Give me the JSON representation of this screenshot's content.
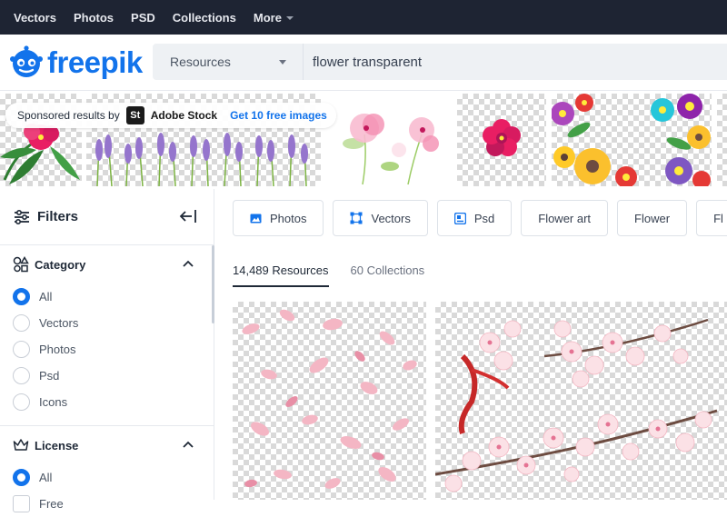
{
  "topnav": {
    "items": [
      "Vectors",
      "Photos",
      "PSD",
      "Collections"
    ],
    "more_label": "More"
  },
  "header": {
    "logo_text": "freepik",
    "resource_select": "Resources",
    "search_value": "flower transparent"
  },
  "sponsored": {
    "by_label": "Sponsored results by",
    "brand_mark": "St",
    "brand_name": "Adobe Stock",
    "free_link": "Get 10 free images"
  },
  "sidebar": {
    "title": "Filters",
    "category": {
      "title": "Category",
      "options": [
        "All",
        "Vectors",
        "Photos",
        "Psd",
        "Icons"
      ],
      "selected": "All"
    },
    "license": {
      "title": "License",
      "options": [
        "All",
        "Free"
      ],
      "selected": "All"
    }
  },
  "main": {
    "chips": [
      "Photos",
      "Vectors",
      "Psd",
      "Flower art",
      "Flower",
      "Fl"
    ],
    "tabs": [
      {
        "label": "14,489 Resources",
        "active": true
      },
      {
        "label": "60 Collections",
        "active": false
      }
    ]
  },
  "colors": {
    "brand": "#1273eb",
    "topnav_bg": "#1e2433",
    "search_bg": "#eef1f4"
  },
  "icons": [
    "freepik-logo-icon",
    "caret-down-icon",
    "filters-icon",
    "collapse-left-icon",
    "category-icon",
    "license-icon",
    "chevron-up-icon",
    "photo-icon",
    "vector-icon",
    "psd-icon"
  ]
}
